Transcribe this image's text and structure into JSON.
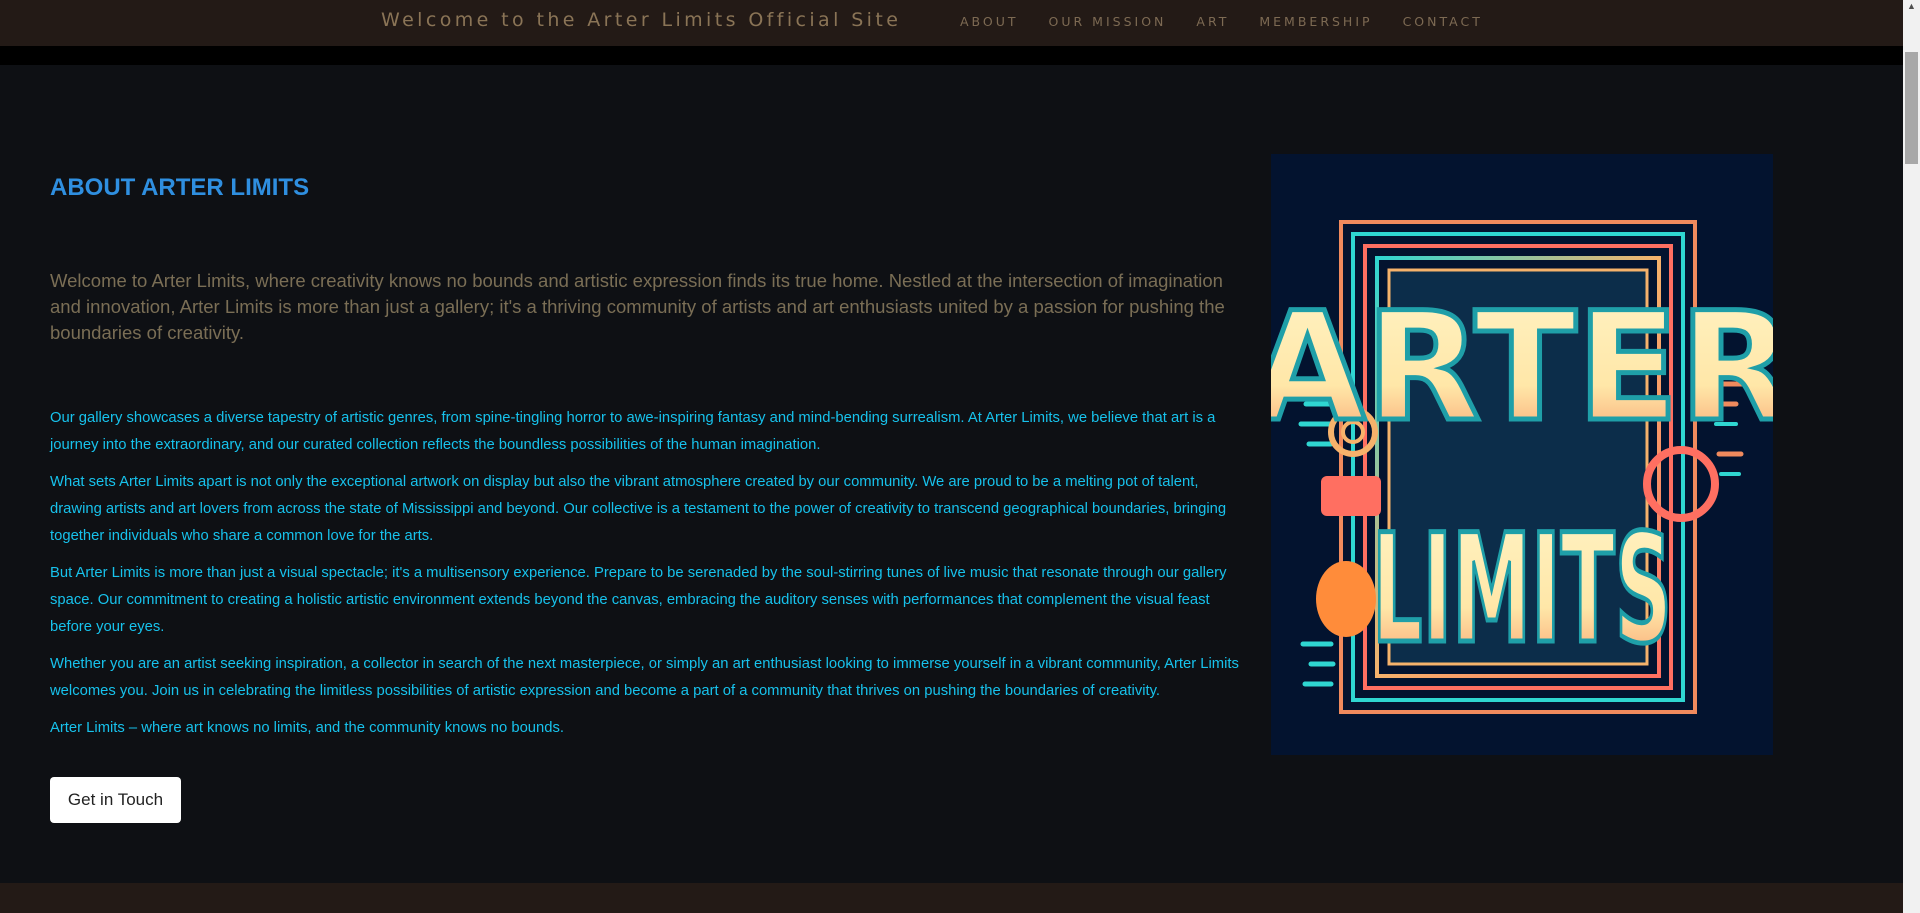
{
  "header": {
    "site_title": "Welcome to the Arter Limits Official Site",
    "nav": [
      "ABOUT",
      "OUR MISSION",
      "ART",
      "MEMBERSHIP",
      "CONTACT"
    ]
  },
  "about": {
    "heading": "ABOUT ARTER LIMITS",
    "lead": "Welcome to Arter Limits, where creativity knows no bounds and artistic expression finds its true home. Nestled at the intersection of imagination and innovation, Arter Limits is more than just a gallery; it's a thriving community of artists and art enthusiasts united by a passion for pushing the boundaries of creativity.",
    "paragraphs": [
      "Our gallery showcases a diverse tapestry of artistic genres, from spine-tingling horror to awe-inspiring fantasy and mind-bending surrealism. At Arter Limits, we believe that art is a journey into the extraordinary, and our curated collection reflects the boundless possibilities of the human imagination.",
      "What sets Arter Limits apart is not only the exceptional artwork on display but also the vibrant atmosphere created by our community. We are proud to be a melting pot of talent, drawing artists and art lovers from across the state of Mississippi and beyond. Our collective is a testament to the power of creativity to transcend geographical boundaries, bringing together individuals who share a common love for the arts.",
      "But Arter Limits is more than just a visual spectacle; it's a multisensory experience. Prepare to be serenaded by the soul-stirring tunes of live music that resonate through our gallery space. Our commitment to creating a holistic artistic environment extends beyond the canvas, embracing the auditory senses with performances that complement the visual feast before your eyes.",
      "Whether you are an artist seeking inspiration, a collector in search of the next masterpiece, or simply an art enthusiast looking to immerse yourself in a vibrant community, Arter Limits welcomes you. Join us in celebrating the limitless possibilities of artistic expression and become a part of a community that thrives on pushing the boundaries of creativity.",
      "Arter Limits – where art knows no limits, and the community knows no bounds."
    ],
    "cta_label": "Get in Touch"
  },
  "poster": {
    "line1": "ARTER",
    "line2": "LIMITS"
  },
  "colors": {
    "topbar_bg": "#231a16",
    "page_bg": "#0e1014",
    "heading": "#2f8fe0",
    "lead_text": "#7a6e55",
    "body_text": "#17c2ec",
    "poster_bg": "#03132f"
  },
  "icons": {
    "scroll_up": "triangle-up-icon"
  }
}
